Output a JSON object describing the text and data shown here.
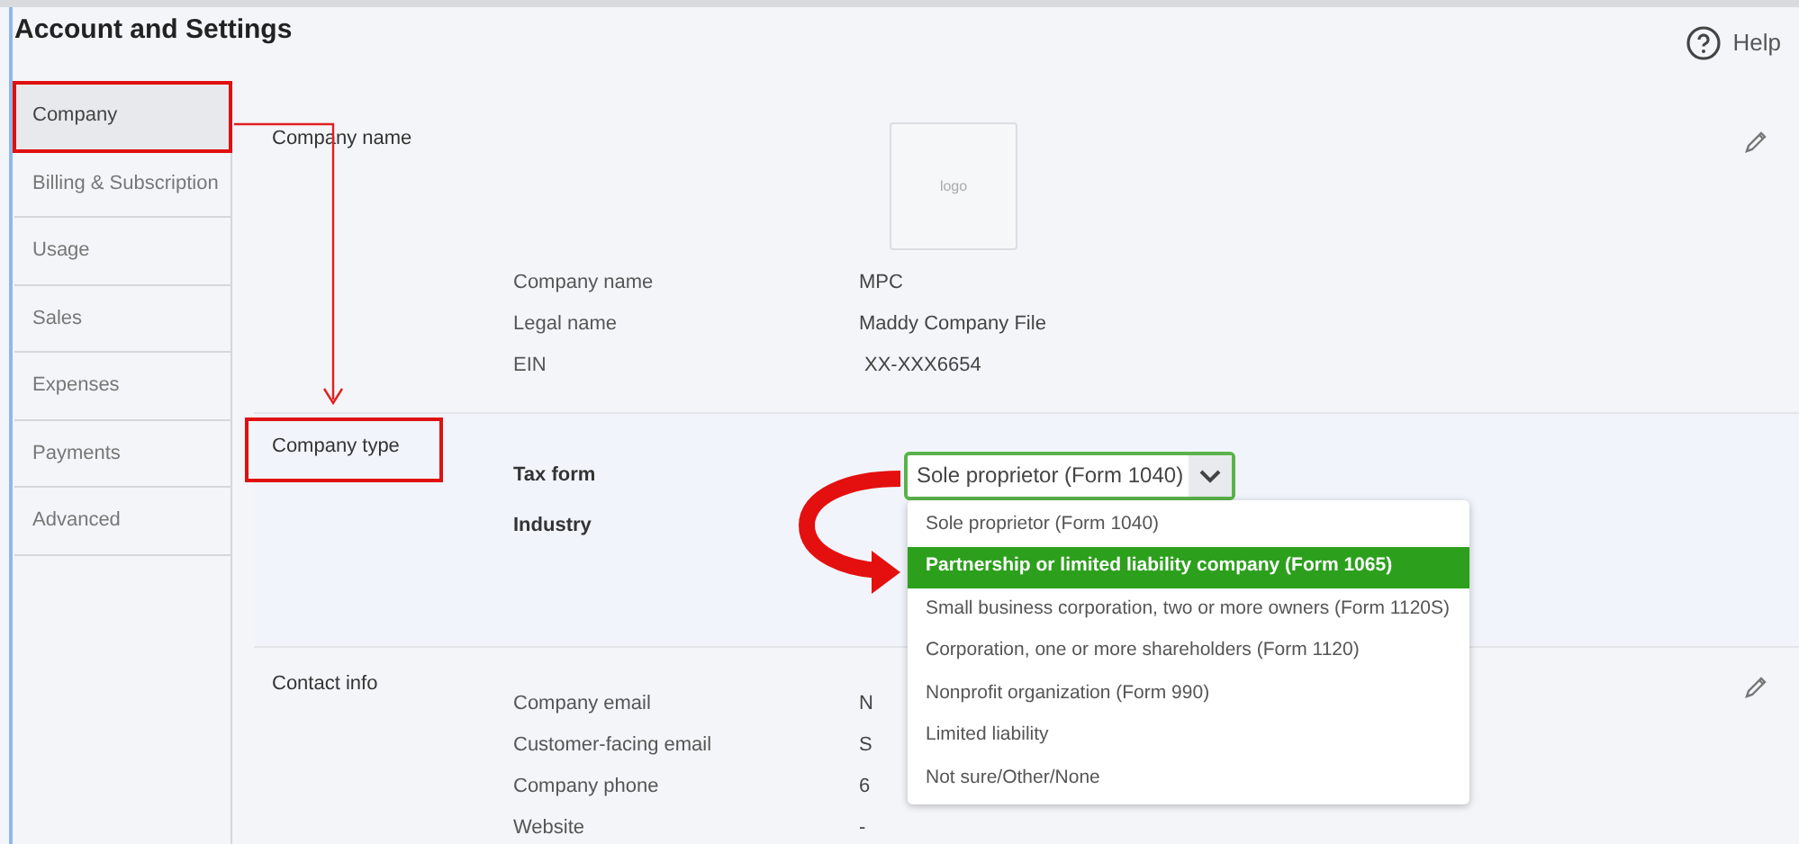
{
  "page": {
    "title": "Account and Settings",
    "help": "Help"
  },
  "sidebar": [
    {
      "label": "Company",
      "selected": true,
      "highlighted": true
    },
    {
      "label": "Billing & Subscription",
      "selected": false,
      "highlighted": false
    },
    {
      "label": "Usage",
      "selected": false,
      "highlighted": false
    },
    {
      "label": "Sales",
      "selected": false,
      "highlighted": false
    },
    {
      "label": "Expenses",
      "selected": false,
      "highlighted": false
    },
    {
      "label": "Payments",
      "selected": false,
      "highlighted": false
    },
    {
      "label": "Advanced",
      "selected": false,
      "highlighted": false
    }
  ],
  "sections": [
    {
      "title": "Company name",
      "highlighted": false,
      "editable": true,
      "logo": "logo",
      "fields": [
        {
          "label": "Company name",
          "kind": "text",
          "value": "MPC"
        },
        {
          "label": "Legal name",
          "kind": "text",
          "value": "Maddy Company File"
        },
        {
          "label": "EIN",
          "kind": "text",
          "value": "XX-XXX6654"
        }
      ]
    },
    {
      "title": "Company type",
      "highlighted": true,
      "editable": false,
      "fields": [
        {
          "label": "Tax form",
          "kind": "select",
          "value": "Sole proprietor (Form 1040)"
        },
        {
          "label": "Industry",
          "kind": "text"
        }
      ]
    },
    {
      "title": "Contact info",
      "highlighted": false,
      "editable": true,
      "fields": [
        {
          "label": "Company email",
          "kind": "text",
          "value": "N"
        },
        {
          "label": "Customer-facing email",
          "kind": "text",
          "value": "S"
        },
        {
          "label": "Company phone",
          "kind": "text",
          "value": "6"
        },
        {
          "label": "Website",
          "kind": "text",
          "value": "-"
        }
      ]
    }
  ],
  "dropdown": {
    "options": [
      {
        "label": "Sole proprietor (Form 1040)",
        "selected": false
      },
      {
        "label": "Partnership or limited liability company (Form 1065)",
        "selected": true
      },
      {
        "label": "Small business corporation, two or more owners (Form 1120S)",
        "selected": false
      },
      {
        "label": "Corporation, one or more shareholders (Form 1120)",
        "selected": false
      },
      {
        "label": "Nonprofit organization (Form 990)",
        "selected": false
      },
      {
        "label": "Limited liability",
        "selected": false
      },
      {
        "label": "Not sure/Other/None",
        "selected": false
      }
    ]
  }
}
